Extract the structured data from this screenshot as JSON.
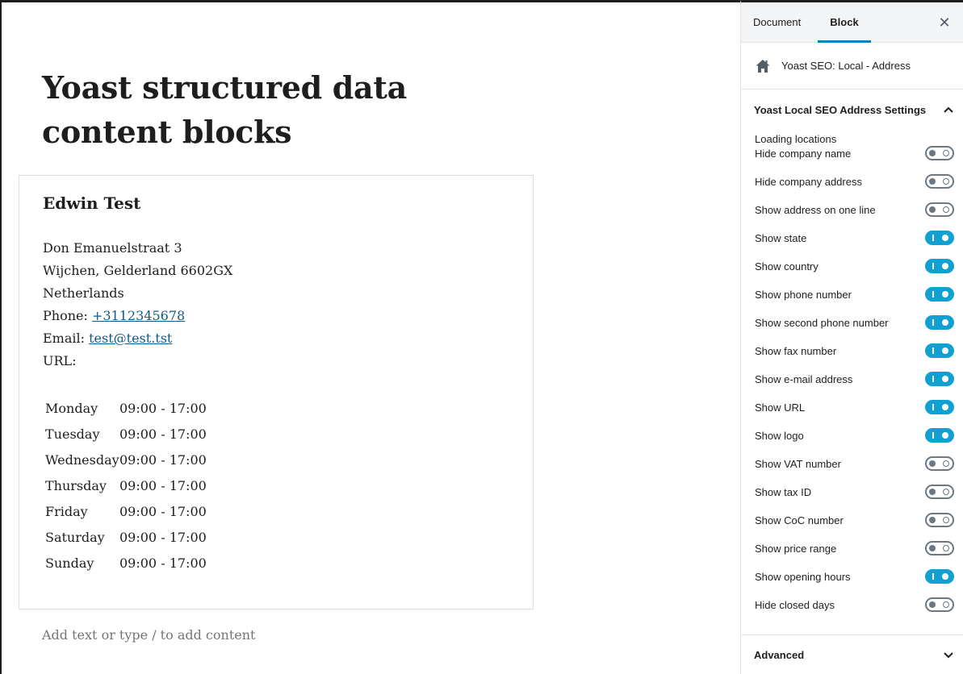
{
  "editor": {
    "title": "Yoast structured data content blocks",
    "business_name": "Edwin Test",
    "street": "Don Emanuelstraat 3",
    "city_line": "Wijchen, Gelderland 6602GX",
    "country": "Netherlands",
    "phone_label": "Phone:",
    "phone": "+3112345678",
    "email_label": "Email:",
    "email": "test@test.tst",
    "url_label": "URL:",
    "hours": [
      {
        "day": "Monday",
        "time": "09:00 - 17:00"
      },
      {
        "day": "Tuesday",
        "time": "09:00 - 17:00"
      },
      {
        "day": "Wednesday",
        "time": "09:00 - 17:00"
      },
      {
        "day": "Thursday",
        "time": "09:00 - 17:00"
      },
      {
        "day": "Friday",
        "time": "09:00 - 17:00"
      },
      {
        "day": "Saturday",
        "time": "09:00 - 17:00"
      },
      {
        "day": "Sunday",
        "time": "09:00 - 17:00"
      }
    ],
    "placeholder": "Add text or type / to add content"
  },
  "sidebar": {
    "tabs": [
      "Document",
      "Block"
    ],
    "active_tab": "Block",
    "close_icon": "close-icon",
    "block_card": {
      "icon": "home-icon",
      "title": "Yoast SEO: Local - Address"
    },
    "panel_title": "Yoast Local SEO Address Settings",
    "loading_text": "Loading locations",
    "toggles": [
      {
        "label": "Hide company name",
        "on": false
      },
      {
        "label": "Hide company address",
        "on": false
      },
      {
        "label": "Show address on one line",
        "on": false
      },
      {
        "label": "Show state",
        "on": true
      },
      {
        "label": "Show country",
        "on": true
      },
      {
        "label": "Show phone number",
        "on": true
      },
      {
        "label": "Show second phone number",
        "on": true
      },
      {
        "label": "Show fax number",
        "on": true
      },
      {
        "label": "Show e-mail address",
        "on": true
      },
      {
        "label": "Show URL",
        "on": true
      },
      {
        "label": "Show logo",
        "on": true
      },
      {
        "label": "Show VAT number",
        "on": false
      },
      {
        "label": "Show tax ID",
        "on": false
      },
      {
        "label": "Show CoC number",
        "on": false
      },
      {
        "label": "Show price range",
        "on": false
      },
      {
        "label": "Show opening hours",
        "on": true
      },
      {
        "label": "Hide closed days",
        "on": false
      }
    ],
    "advanced_title": "Advanced"
  },
  "colors": {
    "accent": "#11a0d2",
    "tab_underline": "#0085ba",
    "link": "#0f5a8a"
  }
}
